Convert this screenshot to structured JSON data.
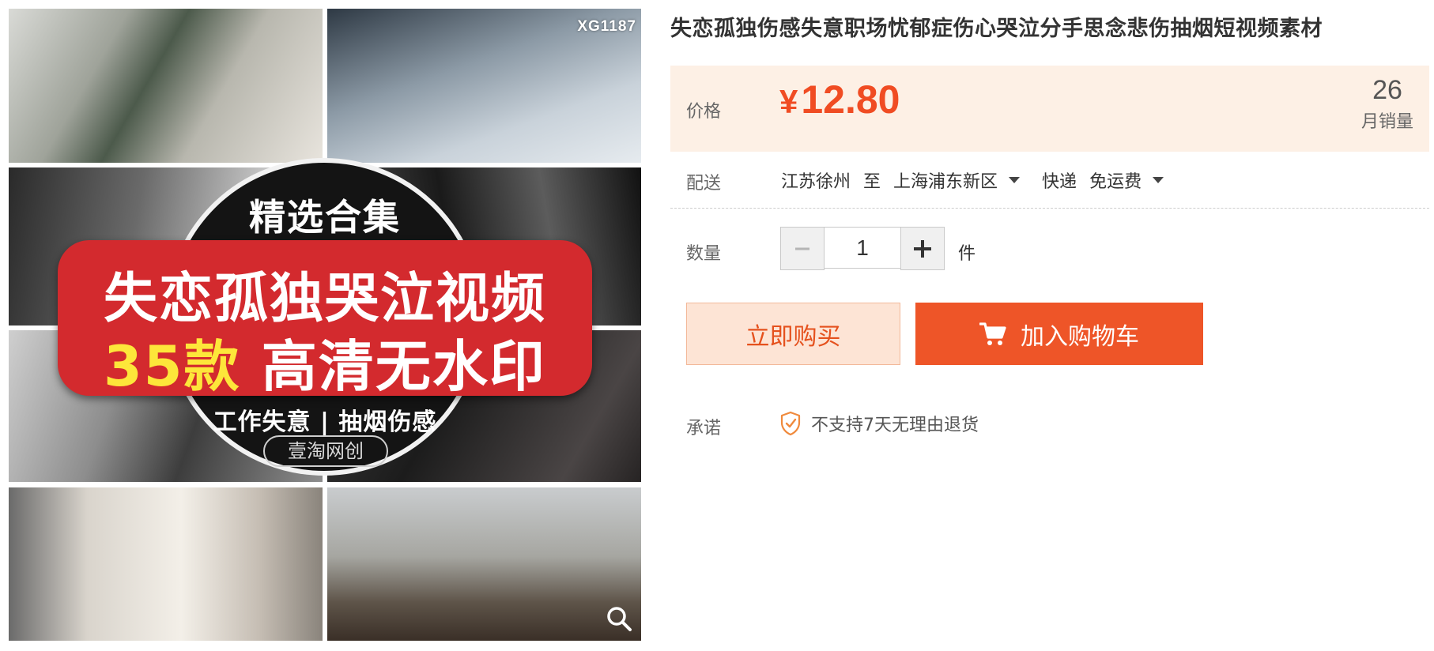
{
  "gallery": {
    "code": "XG1187",
    "collection_title": "精选合集",
    "banner_line1": "失恋孤独哭泣视频",
    "banner_count": "35款",
    "banner_quality": "高清无水印",
    "tags": "工作失意 | 抽烟伤感",
    "brand": "壹淘网创",
    "zoom_icon": "magnifier-icon"
  },
  "product": {
    "title": "失恋孤独伤感失意职场忧郁症伤心哭泣分手思念悲伤抽烟短视频素材"
  },
  "price": {
    "label": "价格",
    "currency": "¥",
    "value": "12.80",
    "sales_count": "26",
    "sales_label": "月销量",
    "accent_color": "#f04c23"
  },
  "shipping": {
    "label": "配送",
    "origin": "江苏徐州",
    "to": "至",
    "destination": "上海浦东新区",
    "method": "快递",
    "fee": "免运费"
  },
  "quantity": {
    "label": "数量",
    "value": "1",
    "unit": "件",
    "minus_icon": "minus-icon",
    "plus_icon": "plus-icon"
  },
  "actions": {
    "buy_now": "立即购买",
    "add_to_cart": "加入购物车",
    "cart_icon": "cart-icon"
  },
  "promise": {
    "label": "承诺",
    "text": "不支持7天无理由退货",
    "icon": "shield-check-icon"
  }
}
